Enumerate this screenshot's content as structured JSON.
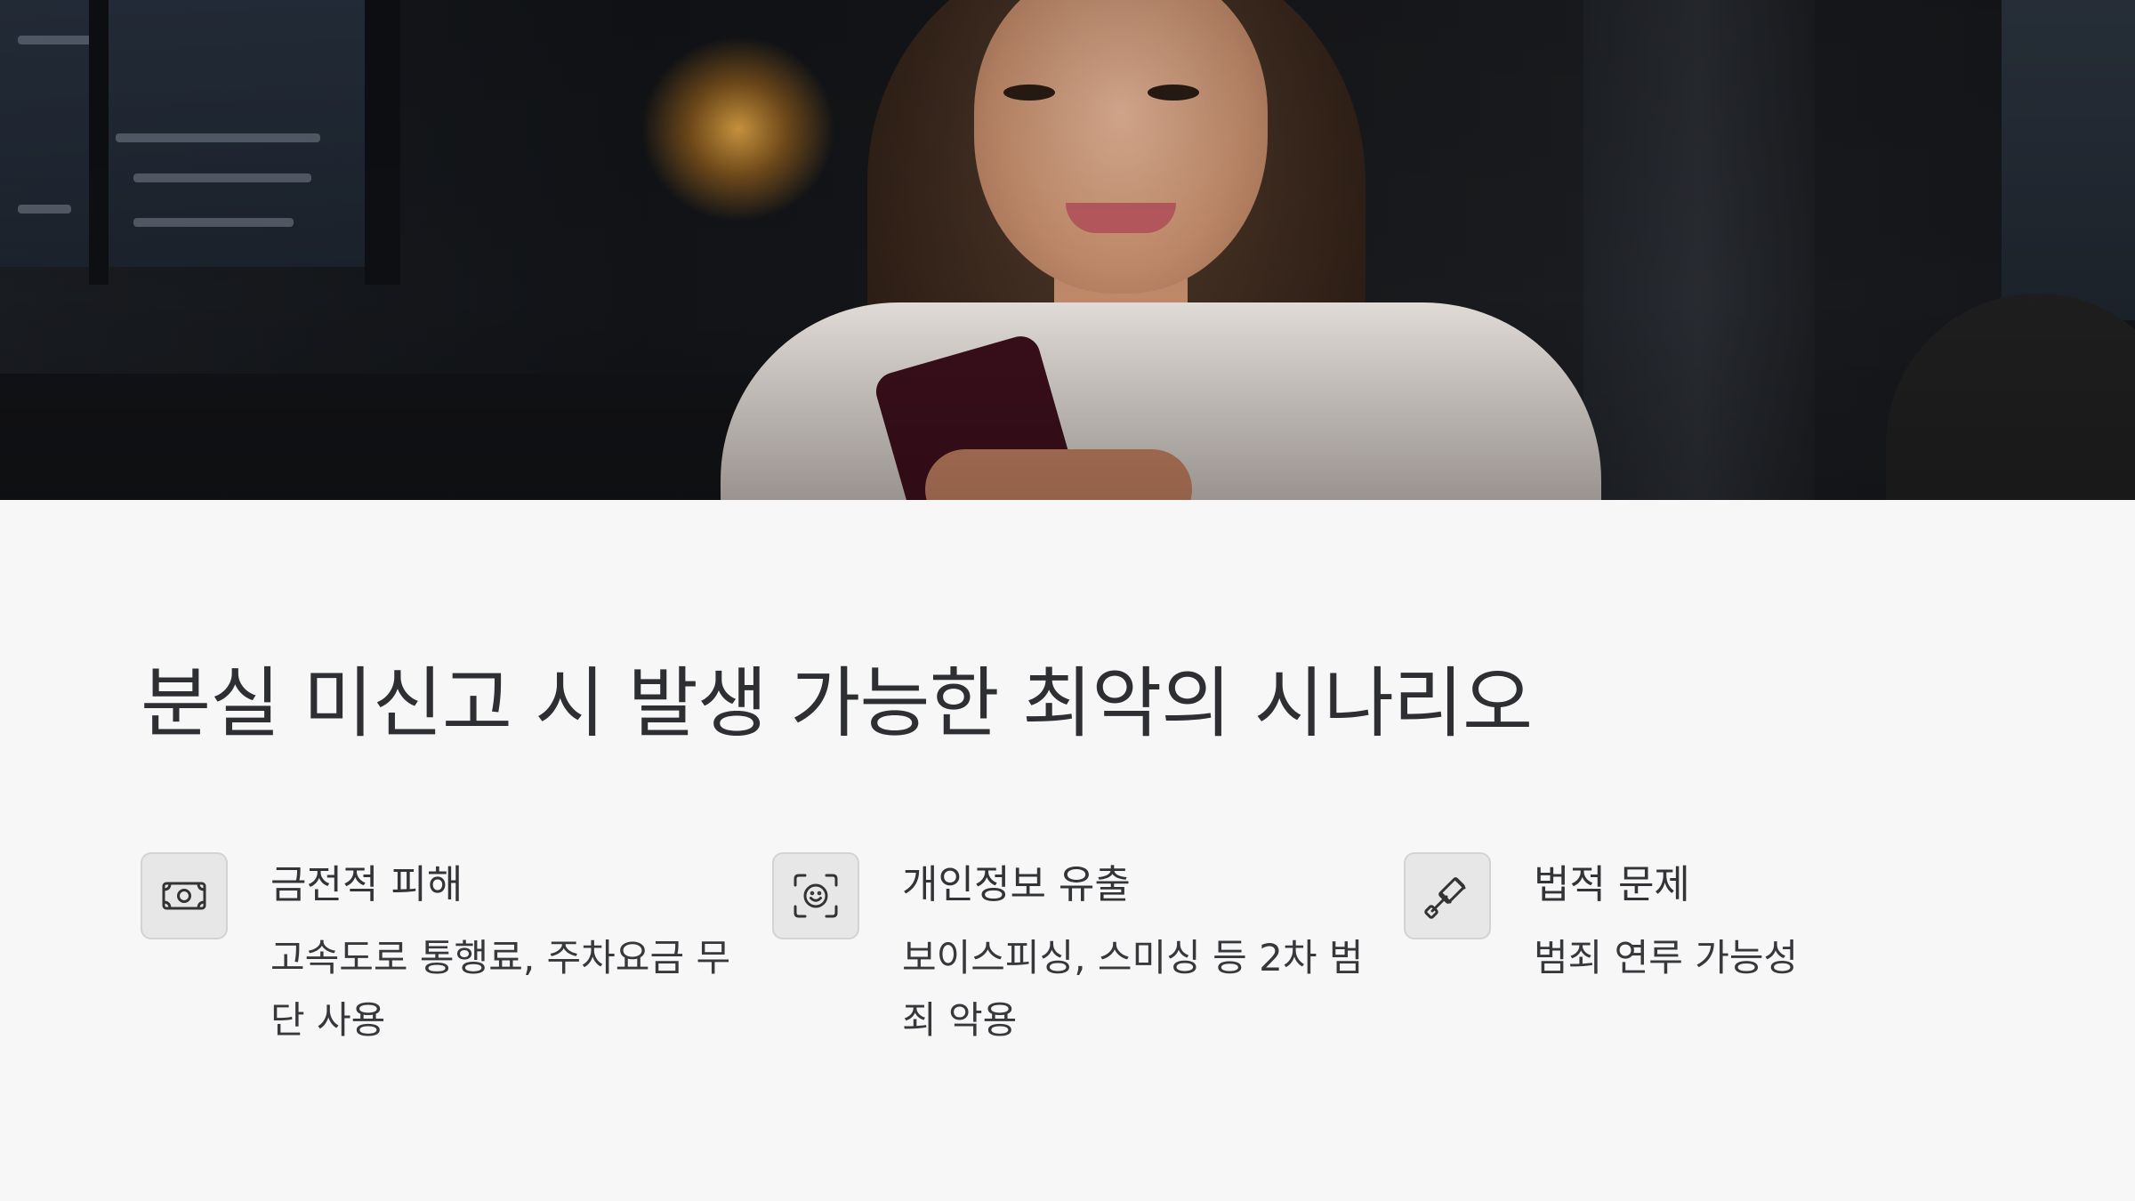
{
  "hero": {
    "image_description_icon": "woman-smiling-at-phone-photo"
  },
  "title": "분실 미신고 시 발생 가능한 최악의 시나리오",
  "cards": [
    {
      "icon": "money-bill-icon",
      "heading": "금전적 피해",
      "body": "고속도로 통행료, 주차요금 무단 사용"
    },
    {
      "icon": "face-scan-icon",
      "heading": "개인정보 유출",
      "body": "보이스피싱, 스미싱 등 2차 범죄 악용"
    },
    {
      "icon": "gavel-icon",
      "heading": "법적 문제",
      "body": "범죄 연루 가능성"
    }
  ],
  "colors": {
    "background": "#f7f7f7",
    "text": "#2e2f33",
    "icon_box": "#e7e7e7"
  }
}
